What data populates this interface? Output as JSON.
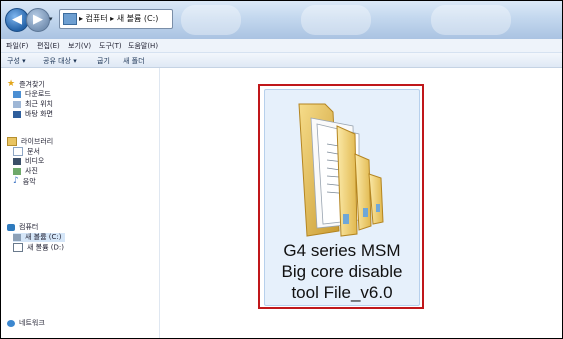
{
  "window": {
    "address": {
      "path": "▸ 컴퓨터 ▸ 새 볼륨 (C:)",
      "drop": "▾"
    },
    "nav": {
      "back": "◀",
      "forward": "▶"
    }
  },
  "menu": {
    "items": [
      "파일(F)",
      "편집(E)",
      "보기(V)",
      "도구(T)",
      "도움말(H)"
    ]
  },
  "toolbar": {
    "items": [
      "구성 ▾",
      "공유 대상 ▾",
      "굽기",
      "새 폴더"
    ]
  },
  "navpane": {
    "favorites": {
      "label": "즐겨찾기",
      "items": [
        "다운로드",
        "최근 위치",
        "바탕 화면"
      ]
    },
    "libraries": {
      "label": "라이브러리",
      "items": [
        "문서",
        "비디오",
        "사진",
        "음악"
      ]
    },
    "computer": {
      "label": "컴퓨터",
      "items": [
        "새 볼륨 (C:)",
        "새 볼륨 (D:)"
      ]
    },
    "network": {
      "label": "네트워크"
    }
  },
  "content": {
    "folder": {
      "name_lines": [
        "G4 series MSM",
        "Big core disable",
        "tool File_v6.0"
      ]
    }
  },
  "colors": {
    "highlight_border": "#c0171a",
    "selection": "#e6f0fb",
    "titlebar": "#c3d7ee"
  }
}
